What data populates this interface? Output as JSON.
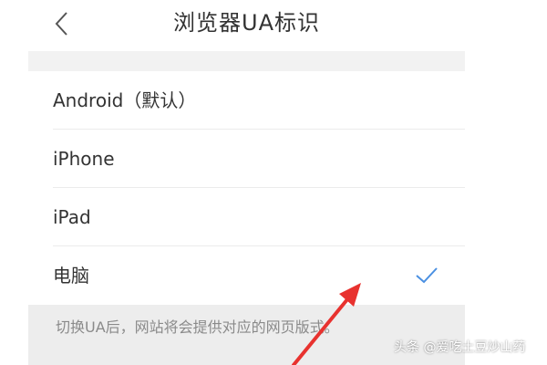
{
  "header": {
    "title": "浏览器UA标识",
    "back_icon": "chevron-left-icon"
  },
  "options": [
    {
      "label": "Android（默认）",
      "selected": false
    },
    {
      "label": "iPhone",
      "selected": false
    },
    {
      "label": "iPad",
      "selected": false
    },
    {
      "label": "电脑",
      "selected": true
    }
  ],
  "footer": {
    "note": "切换UA后，网站将会提供对应的网页版式。"
  },
  "watermark": {
    "text": "头条 @爱吃土豆炒山药"
  },
  "colors": {
    "check": "#4a90e2",
    "arrow": "#e8322f",
    "text": "#333333",
    "note": "#8a8a8a"
  },
  "icons": {
    "check": "checkmark-icon"
  }
}
